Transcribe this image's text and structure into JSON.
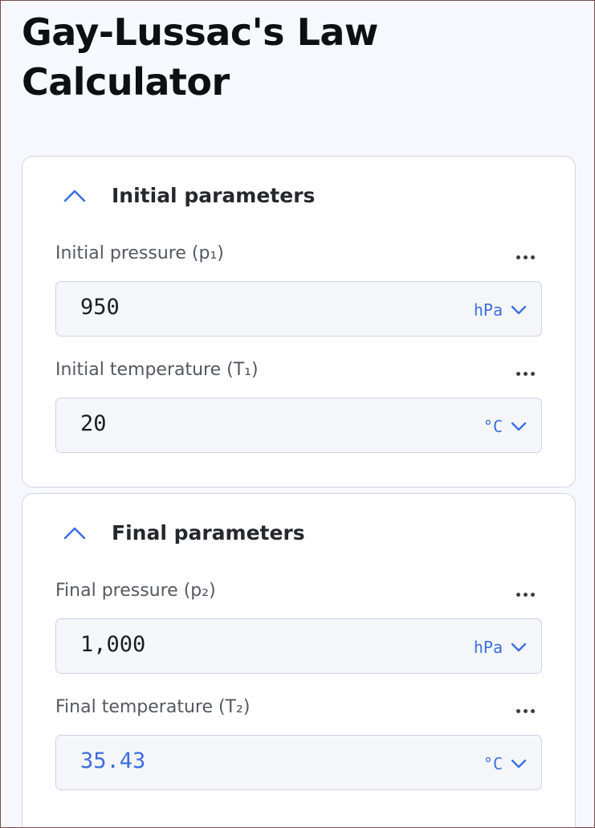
{
  "page": {
    "title": "Gay-Lussac's Law Calculator"
  },
  "sections": [
    {
      "title": "Initial parameters",
      "fields": [
        {
          "label": "Initial pressure (p₁)",
          "value": "950",
          "unit": "hPa",
          "is_result": false
        },
        {
          "label": "Initial temperature (T₁)",
          "value": "20",
          "unit": "°C",
          "is_result": false
        }
      ]
    },
    {
      "title": "Final parameters",
      "fields": [
        {
          "label": "Final pressure (p₂)",
          "value": "1,000",
          "unit": "hPa",
          "is_result": false
        },
        {
          "label": "Final temperature (T₂)",
          "value": "35.43",
          "unit": "°C",
          "is_result": true
        }
      ]
    }
  ],
  "icons": {
    "collapse": "chevron-up-icon",
    "options": "more-horizontal-icon",
    "unit_dropdown": "chevron-down-icon"
  },
  "colors": {
    "accent": "#3d6ee0",
    "border": "#cfd4e2",
    "background": "#f6f8fd"
  }
}
